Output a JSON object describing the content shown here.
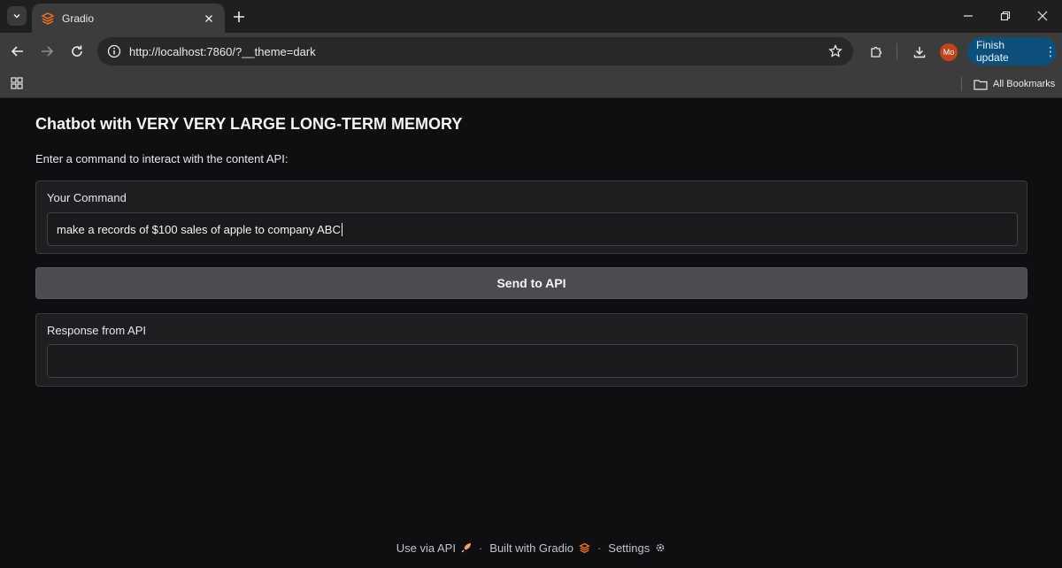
{
  "browser": {
    "tab_title": "Gradio",
    "url": "http://localhost:7860/?__theme=dark",
    "avatar_initials": "Mo",
    "finish_update_label": "Finish update",
    "all_bookmarks_label": "All Bookmarks"
  },
  "app": {
    "title": "Chatbot with VERY VERY LARGE LONG-TERM MEMORY",
    "subtitle": "Enter a command to interact with the content API:",
    "command_label": "Your Command",
    "command_value": "make a records of $100 sales of apple to company ABC",
    "send_button": "Send to API",
    "response_label": "Response from API",
    "response_value": ""
  },
  "footer": {
    "use_api": "Use via API",
    "built_with": "Built with Gradio",
    "settings": "Settings"
  },
  "colors": {
    "page_bg": "#0f0f11",
    "block_bg": "#1f1f22",
    "button_bg": "#4b4b52",
    "gradio_orange": "#f97316",
    "update_button": "#0b4f7a"
  }
}
